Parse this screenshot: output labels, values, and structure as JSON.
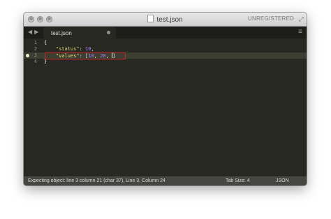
{
  "window": {
    "title": "test.json",
    "unregistered": "UNREGISTERED"
  },
  "tabs": [
    {
      "label": "test.json"
    }
  ],
  "editor": {
    "lines": [
      {
        "number": "1"
      },
      {
        "number": "2"
      },
      {
        "number": "3"
      },
      {
        "number": "4"
      }
    ],
    "status_key": "\"status\"",
    "status_value": "10",
    "values_key": "\"values\"",
    "values_items": [
      "10",
      "20"
    ]
  },
  "statusbar": {
    "message": "Expecting object: line 3 column 21 (char 37), Line 3, Column 24",
    "tab_size": "Tab Size: 4",
    "syntax": "JSON"
  },
  "colors": {
    "background": "#272822",
    "string": "#e6db74",
    "number": "#ae81ff",
    "error_box": "#c52a2a"
  },
  "icons": [
    "close-window-icon",
    "minimize-window-icon",
    "zoom-window-icon",
    "document-icon",
    "fullscreen-icon",
    "nav-back-icon",
    "nav-forward-icon",
    "tab-close-icon",
    "menu-icon",
    "error-marker-icon"
  ]
}
